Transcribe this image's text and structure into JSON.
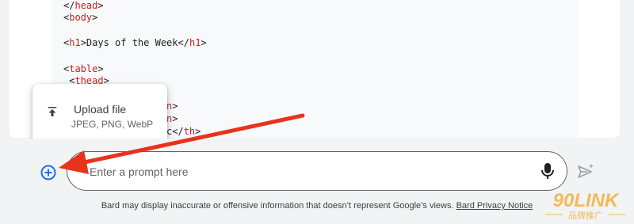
{
  "code": {
    "lines": [
      {
        "parts": [
          {
            "t": "</",
            "tag": false
          },
          {
            "t": "head",
            "tag": true
          },
          {
            "t": ">",
            "tag": false
          }
        ]
      },
      {
        "parts": [
          {
            "t": "<",
            "tag": false
          },
          {
            "t": "body",
            "tag": true
          },
          {
            "t": ">",
            "tag": false
          }
        ]
      },
      {
        "parts": [
          {
            "t": "<",
            "tag": false
          },
          {
            "t": "h1",
            "tag": true
          },
          {
            "t": ">Days of the Week</",
            "tag": false
          },
          {
            "t": "h1",
            "tag": true
          },
          {
            "t": ">",
            "tag": false
          }
        ]
      },
      {
        "parts": [
          {
            "t": "<",
            "tag": false
          },
          {
            "t": "table",
            "tag": true
          },
          {
            "t": ">",
            "tag": false
          }
        ]
      },
      {
        "parts": [
          {
            "t": " <",
            "tag": false
          },
          {
            "t": "thead",
            "tag": true
          },
          {
            "t": ">",
            "tag": false
          }
        ]
      },
      {
        "parts": [
          {
            "t": "n",
            "tag": true
          },
          {
            "t": ">",
            "tag": false
          }
        ]
      },
      {
        "parts": [
          {
            "t": "n",
            "tag": true
          },
          {
            "t": ">",
            "tag": false
          }
        ]
      },
      {
        "parts": [
          {
            "t": "c</",
            "tag": false
          },
          {
            "t": "th",
            "tag": true
          },
          {
            "t": ">",
            "tag": false
          }
        ]
      }
    ]
  },
  "upload_menu": {
    "title": "Upload file",
    "subtitle": "JPEG, PNG, WebP",
    "icon": "upload-icon"
  },
  "prompt": {
    "placeholder": "Enter a prompt here"
  },
  "footer": {
    "disclaimer": "Bard may display inaccurate or offensive information that doesn’t represent Google’s views.",
    "privacy_link": "Bard Privacy Notice"
  },
  "watermark": {
    "brand": "90LINK",
    "tagline": "品牌推广"
  },
  "colors": {
    "accent": "#1a73e8",
    "arrow": "#e8331c",
    "code_tag": "#c5221f",
    "watermark": "#f6a623"
  }
}
